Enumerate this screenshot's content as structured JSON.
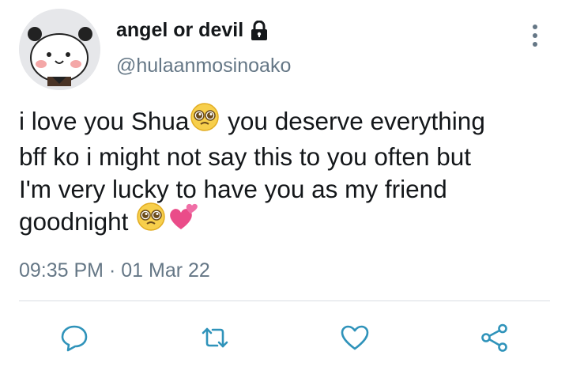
{
  "tweet": {
    "author": {
      "display_name": "angel or devil",
      "handle": "@hulaanmosinoako",
      "avatar_icon": "panda-avatar",
      "protected_icon": "lock-icon"
    },
    "text_lines": [
      "i love you Shua",
      " you deserve everything",
      "bff ko i might not say this to you often but",
      "I'm very lucky to have you as my friend",
      "goodnight "
    ],
    "timestamp": "09:35 PM",
    "separator": "·",
    "date": "01 Mar 22"
  },
  "actions": {
    "reply_icon": "reply-icon",
    "retweet_icon": "retweet-icon",
    "like_icon": "heart-icon",
    "share_icon": "share-icon"
  },
  "colors": {
    "text": "#14171a",
    "secondary": "#657786",
    "icon": "#2f93ba",
    "divider": "#d8dde2"
  }
}
